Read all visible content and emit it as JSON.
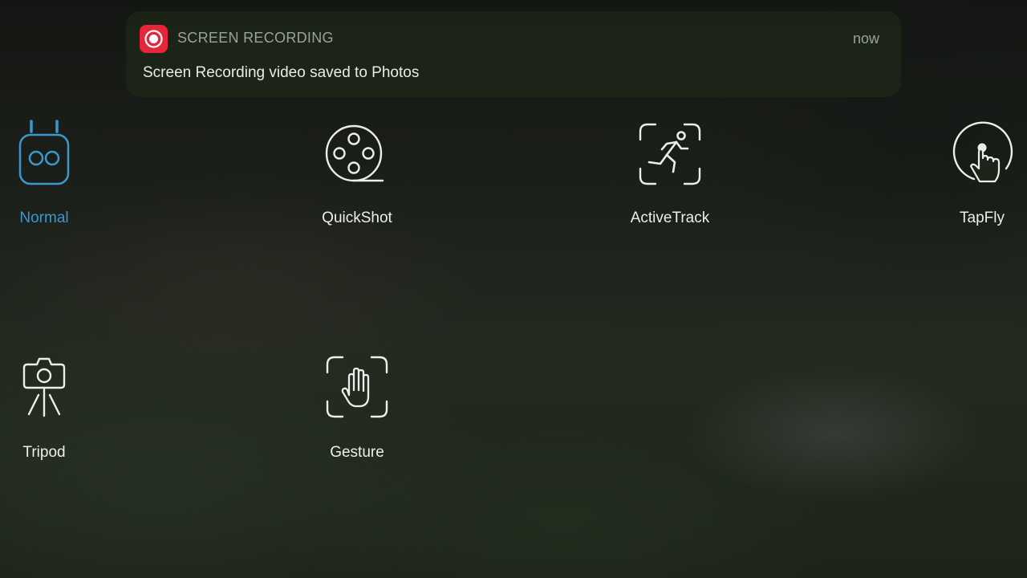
{
  "notification": {
    "app_name": "SCREEN RECORDING",
    "time": "now",
    "message": "Screen Recording video saved to Photos",
    "app_icon": "record-icon",
    "accent_color": "#e7253a"
  },
  "modes": [
    {
      "label": "Normal",
      "icon": "drone-controller-icon",
      "selected": true
    },
    {
      "label": "QuickShot",
      "icon": "film-reel-icon",
      "selected": false
    },
    {
      "label": "ActiveTrack",
      "icon": "running-person-frame-icon",
      "selected": false
    },
    {
      "label": "TapFly",
      "icon": "tap-pointer-icon",
      "selected": false
    },
    {
      "label": "Tripod",
      "icon": "camera-tripod-icon",
      "selected": false
    },
    {
      "label": "Gesture",
      "icon": "hand-frame-icon",
      "selected": false
    }
  ],
  "colors": {
    "selected": "#3d97cf",
    "label": "#ecefe9"
  }
}
